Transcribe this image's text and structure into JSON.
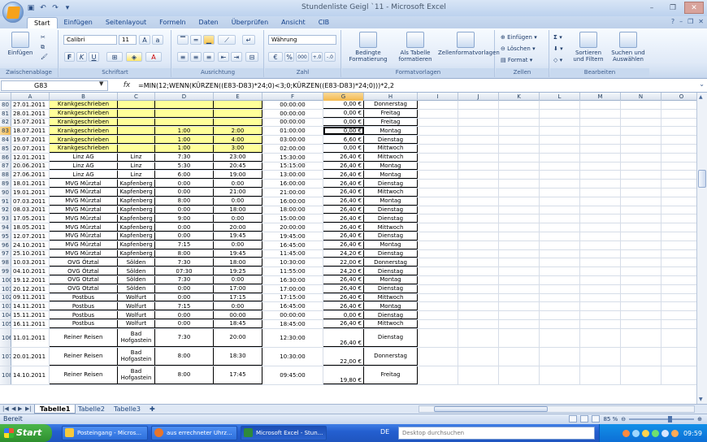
{
  "window": {
    "title": "Stundenliste Geigl `11 - Microsoft Excel"
  },
  "ribbon_tabs": [
    "Start",
    "Einfügen",
    "Seitenlayout",
    "Formeln",
    "Daten",
    "Überprüfen",
    "Ansicht",
    "CIB"
  ],
  "ribbon": {
    "clipboard": {
      "label": "Zwischenablage",
      "paste": "Einfügen"
    },
    "font": {
      "label": "Schriftart",
      "name": "Calibri",
      "size": "11",
      "bold": "F",
      "italic": "K",
      "underline": "U"
    },
    "alignment": {
      "label": "Ausrichtung"
    },
    "number": {
      "label": "Zahl",
      "format": "Währung",
      "percent": "%",
      "thousands": "000"
    },
    "styles": {
      "label": "Formatvorlagen",
      "conditional": "Bedingte Formatierung",
      "table": "Als Tabelle formatieren",
      "cell": "Zellenformatvorlagen"
    },
    "cells": {
      "label": "Zellen",
      "insert": "Einfügen",
      "delete": "Löschen",
      "format": "Format"
    },
    "editing": {
      "label": "Bearbeiten",
      "sort": "Sortieren und Filtern",
      "find": "Suchen und Auswählen"
    }
  },
  "formula_bar": {
    "name_box": "G83",
    "fx": "fx",
    "formula": "=MIN(12;WENN(KÜRZEN((E83-D83)*24;0)<3;0;KÜRZEN((E83-D83)*24;0)))*2,2"
  },
  "columns": [
    "A",
    "B",
    "C",
    "D",
    "E",
    "F",
    "G",
    "H",
    "I",
    "J",
    "K",
    "L",
    "M",
    "N",
    "O"
  ],
  "rows": [
    {
      "n": "80",
      "a": "27.01.2011",
      "b": "Krankgeschrieben",
      "c": "",
      "d": "",
      "e": "",
      "f": "00:00:00",
      "g": "0,00 €",
      "h": "Donnerstag",
      "y": true
    },
    {
      "n": "81",
      "a": "28.01.2011",
      "b": "Krankgeschrieben",
      "c": "",
      "d": "",
      "e": "",
      "f": "00:00:00",
      "g": "0,00 €",
      "h": "Freitag",
      "y": true
    },
    {
      "n": "82",
      "a": "15.07.2011",
      "b": "Krankgeschrieben",
      "c": "",
      "d": "",
      "e": "",
      "f": "00:00:00",
      "g": "0,00 €",
      "h": "Freitag",
      "y": true
    },
    {
      "n": "83",
      "a": "18.07.2011",
      "b": "Krankgeschrieben",
      "c": "",
      "d": "1:00",
      "e": "2:00",
      "f": "01:00:00",
      "g": "0,00 €",
      "h": "Montag",
      "y": true,
      "sel": true
    },
    {
      "n": "84",
      "a": "19.07.2011",
      "b": "Krankgeschrieben",
      "c": "",
      "d": "1:00",
      "e": "4:00",
      "f": "03:00:00",
      "g": "6,60 €",
      "h": "Dienstag",
      "y": true
    },
    {
      "n": "85",
      "a": "20.07.2011",
      "b": "Krankgeschrieben",
      "c": "",
      "d": "1:00",
      "e": "3:00",
      "f": "02:00:00",
      "g": "0,00 €",
      "h": "Mittwoch",
      "y": true
    },
    {
      "n": "86",
      "a": "12.01.2011",
      "b": "Linz AG",
      "c": "Linz",
      "d": "7:30",
      "e": "23:00",
      "f": "15:30:00",
      "g": "26,40 €",
      "h": "Mittwoch"
    },
    {
      "n": "87",
      "a": "20.06.2011",
      "b": "Linz AG",
      "c": "Linz",
      "d": "5:30",
      "e": "20:45",
      "f": "15:15:00",
      "g": "26,40 €",
      "h": "Montag"
    },
    {
      "n": "88",
      "a": "27.06.2011",
      "b": "Linz AG",
      "c": "Linz",
      "d": "6:00",
      "e": "19:00",
      "f": "13:00:00",
      "g": "26,40 €",
      "h": "Montag"
    },
    {
      "n": "89",
      "a": "18.01.2011",
      "b": "MVG Mürztal",
      "c": "Kapfenberg",
      "d": "0:00",
      "e": "0:00",
      "f": "16:00:00",
      "g": "26,40 €",
      "h": "Dienstag"
    },
    {
      "n": "90",
      "a": "19.01.2011",
      "b": "MVG Mürztal",
      "c": "Kapfenberg",
      "d": "0:00",
      "e": "21:00",
      "f": "21:00:00",
      "g": "26,40 €",
      "h": "Mittwoch"
    },
    {
      "n": "91",
      "a": "07.03.2011",
      "b": "MVG Mürztal",
      "c": "Kapfenberg",
      "d": "8:00",
      "e": "0:00",
      "f": "16:00:00",
      "g": "26,40 €",
      "h": "Montag"
    },
    {
      "n": "92",
      "a": "08.03.2011",
      "b": "MVG Mürztal",
      "c": "Kapfenberg",
      "d": "0:00",
      "e": "18:00",
      "f": "18:00:00",
      "g": "26,40 €",
      "h": "Dienstag"
    },
    {
      "n": "93",
      "a": "17.05.2011",
      "b": "MVG Mürztal",
      "c": "Kapfenberg",
      "d": "9:00",
      "e": "0:00",
      "f": "15:00:00",
      "g": "26,40 €",
      "h": "Dienstag"
    },
    {
      "n": "94",
      "a": "18.05.2011",
      "b": "MVG Mürztal",
      "c": "Kapfenberg",
      "d": "0:00",
      "e": "20:00",
      "f": "20:00:00",
      "g": "26,40 €",
      "h": "Mittwoch"
    },
    {
      "n": "95",
      "a": "12.07.2011",
      "b": "MVG Mürztal",
      "c": "Kapfenberg",
      "d": "0:00",
      "e": "19:45",
      "f": "19:45:00",
      "g": "26,40 €",
      "h": "Dienstag"
    },
    {
      "n": "96",
      "a": "24.10.2011",
      "b": "MVG Mürztal",
      "c": "Kapfenberg",
      "d": "7:15",
      "e": "0:00",
      "f": "16:45:00",
      "g": "26,40 €",
      "h": "Montag"
    },
    {
      "n": "97",
      "a": "25.10.2011",
      "b": "MVG Mürztal",
      "c": "Kapfenberg",
      "d": "8:00",
      "e": "19:45",
      "f": "11:45:00",
      "g": "24,20 €",
      "h": "Dienstag"
    },
    {
      "n": "98",
      "a": "10.03.2011",
      "b": "OVG Ötztal",
      "c": "Sölden",
      "d": "7:30",
      "e": "18:00",
      "f": "10:30:00",
      "g": "22,00 €",
      "h": "Donnerstag"
    },
    {
      "n": "99",
      "a": "04.10.2011",
      "b": "OVG Ötztal",
      "c": "Sölden",
      "d": "07:30",
      "e": "19:25",
      "f": "11:55:00",
      "g": "24,20 €",
      "h": "Dienstag"
    },
    {
      "n": "100",
      "a": "19.12.2011",
      "b": "OVG Ötztal",
      "c": "Sölden",
      "d": "7:30",
      "e": "0:00",
      "f": "16:30:00",
      "g": "26,40 €",
      "h": "Montag"
    },
    {
      "n": "101",
      "a": "20.12.2011",
      "b": "OVG Ötztal",
      "c": "Sölden",
      "d": "0:00",
      "e": "17:00",
      "f": "17:00:00",
      "g": "26,40 €",
      "h": "Dienstag"
    },
    {
      "n": "102",
      "a": "09.11.2011",
      "b": "Postbus",
      "c": "Wolfurt",
      "d": "0:00",
      "e": "17:15",
      "f": "17:15:00",
      "g": "26,40 €",
      "h": "Mittwoch"
    },
    {
      "n": "103",
      "a": "14.11.2011",
      "b": "Postbus",
      "c": "Wolfurt",
      "d": "7:15",
      "e": "0:00",
      "f": "16:45:00",
      "g": "26,40 €",
      "h": "Montag"
    },
    {
      "n": "104",
      "a": "15.11.2011",
      "b": "Postbus",
      "c": "Wolfurt",
      "d": "0:00",
      "e": "00:00",
      "f": "00:00:00",
      "g": "0,00 €",
      "h": "Dienstag"
    },
    {
      "n": "105",
      "a": "16.11.2011",
      "b": "Postbus",
      "c": "Wolfurt",
      "d": "0:00",
      "e": "18:45",
      "f": "18:45:00",
      "g": "26,40 €",
      "h": "Mittwoch"
    },
    {
      "n": "106",
      "a": "11.01.2011",
      "b": "Reiner Reisen",
      "c": "Bad Hofgastein",
      "d": "7:30",
      "e": "20:00",
      "f": "12:30:00",
      "g": "26,40 €",
      "h": "Dienstag",
      "tall": true
    },
    {
      "n": "107",
      "a": "20.01.2011",
      "b": "Reiner Reisen",
      "c": "Bad Hofgastein",
      "d": "8:00",
      "e": "18:30",
      "f": "10:30:00",
      "g": "22,00 €",
      "h": "Donnerstag",
      "tall": true
    },
    {
      "n": "108",
      "a": "14.10.2011",
      "b": "Reiner Reisen",
      "c": "Bad Hofgastein",
      "d": "8:00",
      "e": "17:45",
      "f": "09:45:00",
      "g": "19,80 €",
      "h": "Freitag",
      "tall": true
    }
  ],
  "sheets": [
    "Tabelle1",
    "Tabelle2",
    "Tabelle3"
  ],
  "status": {
    "text": "Bereit",
    "zoom": "85 %"
  },
  "taskbar": {
    "start": "Start",
    "tasks": [
      "Posteingang - Micros...",
      "aus errechneter Uhrz...",
      "Microsoft Excel - Stun..."
    ],
    "lang": "DE",
    "search_placeholder": "Desktop durchsuchen",
    "clock": "09:59"
  },
  "colors": {
    "highlight_yellow": "#ffff99",
    "ribbon_blue": "#dfe9f7",
    "taskbar_blue": "#245fd0"
  }
}
